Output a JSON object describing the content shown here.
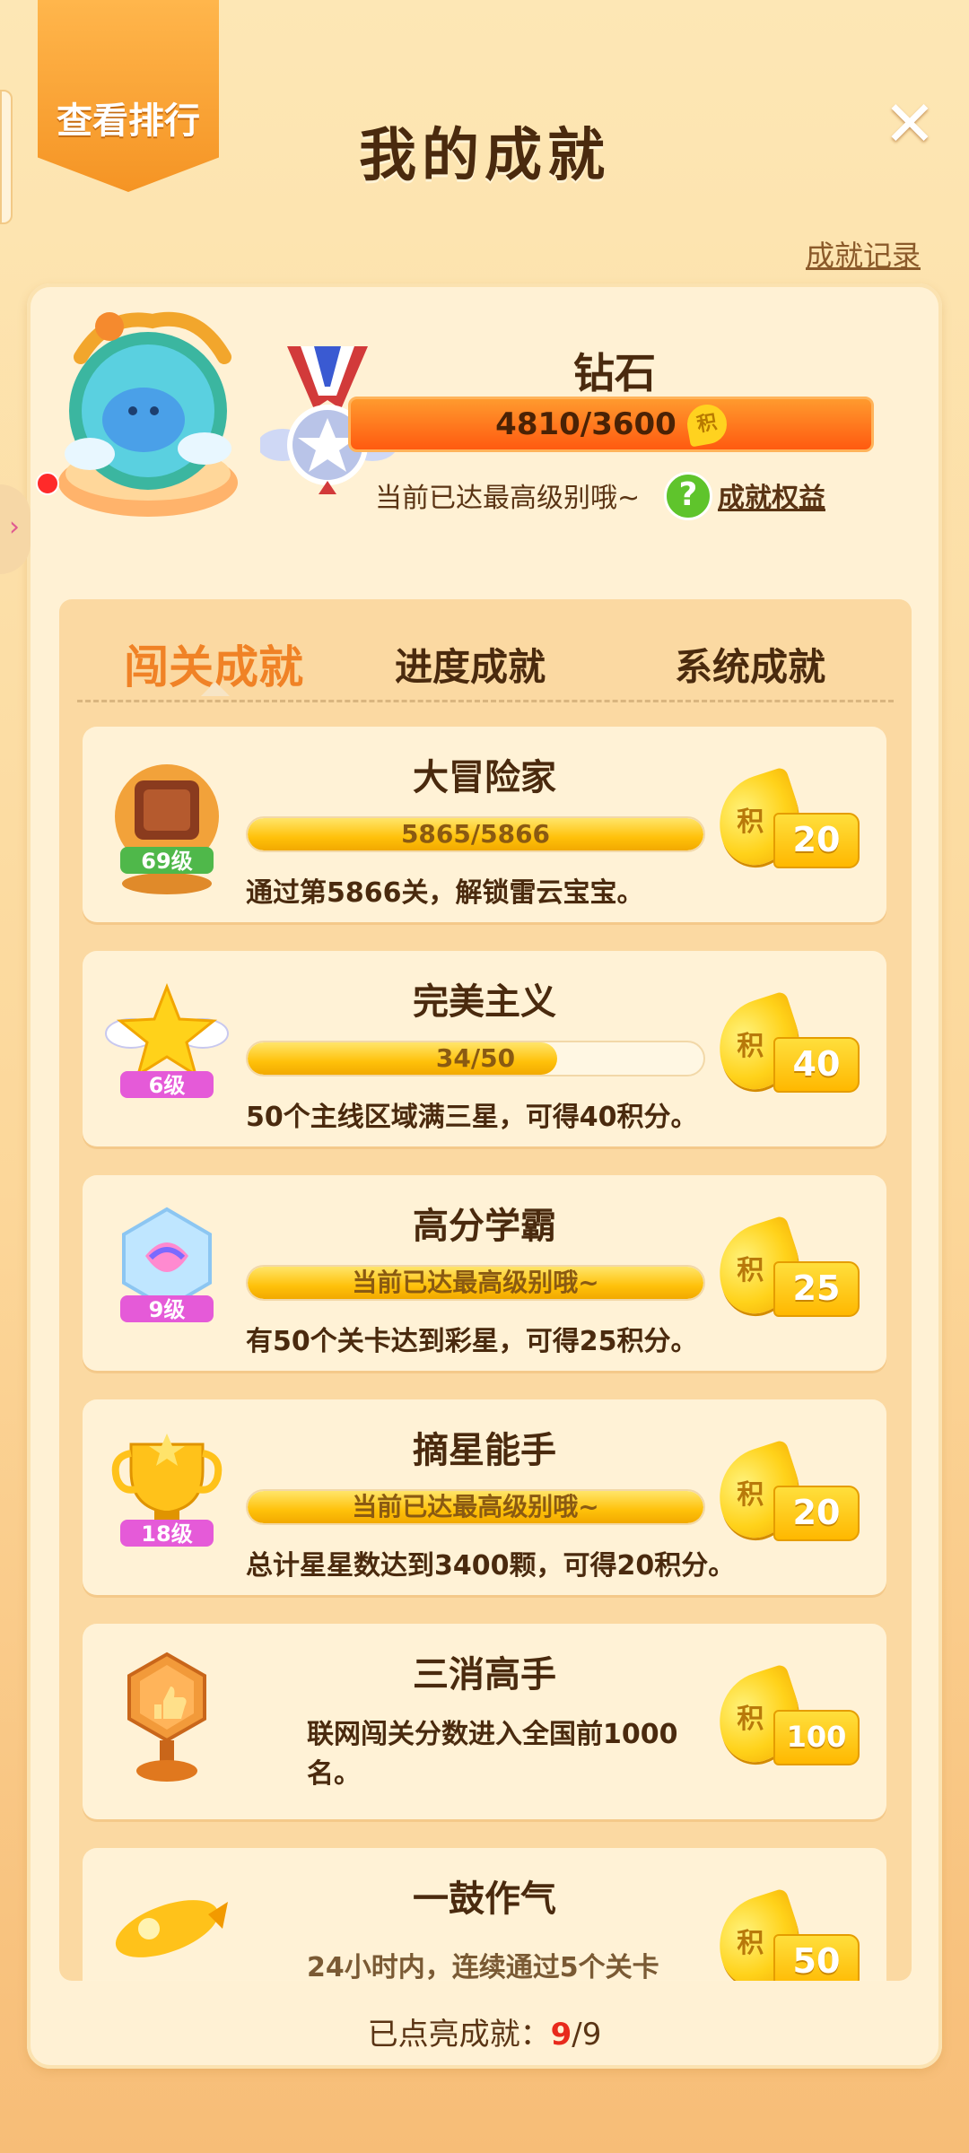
{
  "header": {
    "rank_button": "查看排行",
    "title": "我的成就",
    "record_link": "成就记录"
  },
  "level": {
    "name": "钻石",
    "progress_text": "4810/3600",
    "coin_char": "积",
    "note": "当前已达最高级别哦~",
    "benefit_link": "成就权益"
  },
  "tabs": [
    {
      "label": "闯关成就"
    },
    {
      "label": "进度成就"
    },
    {
      "label": "系统成就"
    }
  ],
  "achievements": [
    {
      "title": "大冒险家",
      "badge": "69级",
      "progress_text": "5865/5866",
      "progress": 0.9998,
      "desc": "通过第5866关，解锁雷云宝宝。",
      "reward": "20"
    },
    {
      "title": "完美主义",
      "badge": "6级",
      "progress_text": "34/50",
      "progress": 0.68,
      "desc": "50个主线区域满三星，可得40积分。",
      "reward": "40"
    },
    {
      "title": "高分学霸",
      "badge": "9级",
      "progress_text": "当前已达最高级别哦~",
      "progress": 1.0,
      "desc": "有50个关卡达到彩星，可得25积分。",
      "reward": "25"
    },
    {
      "title": "摘星能手",
      "badge": "18级",
      "progress_text": "当前已达最高级别哦~",
      "progress": 1.0,
      "desc": "总计星星数达到3400颗，可得20积分。",
      "reward": "20"
    },
    {
      "title": "三消高手",
      "badge": "",
      "desc": "联网闯关分数进入全国前1000名。",
      "desc_line1": "联网闯关分数进入全国前1000",
      "desc_line2": "名。",
      "reward": "100"
    },
    {
      "title": "一鼓作气",
      "badge": "",
      "desc_partial": "24小时内，连续通过5个关卡",
      "reward": "50"
    }
  ],
  "footer": {
    "label": "已点亮成就：",
    "current": "9",
    "total": "/9"
  },
  "colors": {
    "accent_orange": "#f08226",
    "progress_gold": "#ffc10a",
    "highlight_red": "#e82a1c"
  }
}
